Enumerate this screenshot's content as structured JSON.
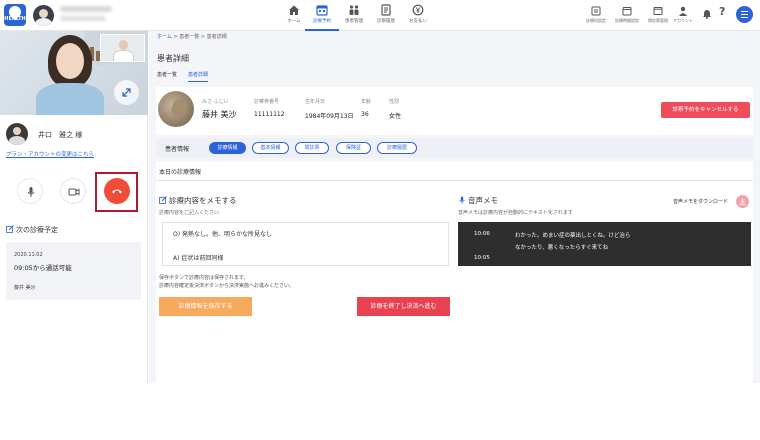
{
  "header": {
    "logo_text": "HEALTH",
    "nav": [
      {
        "label": "ホーム",
        "icon": "home-icon"
      },
      {
        "label": "診療予約",
        "icon": "calendar-icon",
        "active": true
      },
      {
        "label": "患者管理",
        "icon": "patients-icon"
      },
      {
        "label": "診察履歴",
        "icon": "history-icon"
      },
      {
        "label": "お支払い",
        "icon": "payment-icon"
      }
    ],
    "right_nav": [
      {
        "label": "診療科設定",
        "icon": "department-icon"
      },
      {
        "label": "診療時間設定",
        "icon": "schedule-icon"
      },
      {
        "label": "問診票管理",
        "icon": "questionnaire-icon"
      },
      {
        "label": "アカウント",
        "icon": "account-icon"
      }
    ],
    "help": "?"
  },
  "left_panel": {
    "patient_name": "井口　雅之 様",
    "plan_link": "プラン・アカウントの変更はこちら",
    "next": {
      "title": "次の診療予定",
      "date": "2020.11.02",
      "time": "09:05から通話可能",
      "patient": "藤井 美沙"
    }
  },
  "breadcrumb": {
    "home": "ホーム",
    "sep": " > ",
    "list": "患者一覧",
    "current": "患者詳細"
  },
  "page": {
    "title": "患者詳細",
    "tabs": [
      {
        "label": "患者一覧",
        "active": false
      },
      {
        "label": "患者詳細",
        "active": true
      }
    ]
  },
  "patient": {
    "kana": "みさ ふじい",
    "name": "藤井 美沙",
    "card_label": "診察券番号",
    "card_number": "11111112",
    "birth_label": "生年月日",
    "birth": "1984年09月13日",
    "age_label": "年齢",
    "age": "36",
    "sex_label": "性別",
    "sex": "女性",
    "cancel_button": "診察予約をキャンセルする"
  },
  "info_tabs": {
    "label": "患者情報",
    "items": [
      {
        "label": "診療情報",
        "active": true
      },
      {
        "label": "基本情報",
        "active": false
      },
      {
        "label": "問診票",
        "active": false
      },
      {
        "label": "保険証",
        "active": false
      },
      {
        "label": "診療履歴",
        "active": false
      }
    ]
  },
  "today": {
    "title": "本日の診療情報",
    "memo": {
      "title": "診療内容をメモする",
      "subtitle": "診療内容をご記入ください",
      "lines": [
        "O) 発熱なし。他、明らかな所見なし",
        "A) 症状は前回同様"
      ],
      "note1": "保存ボタンで診療内容は保存されます。",
      "note2": "診療内容確定後決済ボタンから決済実施へお進みください。",
      "save_button": "診療情報を保存する",
      "finish_button": "診療を終了し決済へ進む"
    },
    "voice": {
      "title": "音声メモ",
      "subtitle": "音声メモは診療内容が自動的にテキスト化されます",
      "download_label": "音声メモをダウンロード",
      "entries": [
        {
          "time": "10:06",
          "text": "わかった。めまい症の薬出しとくね。けど治ら"
        },
        {
          "time": "",
          "text": "なかったり、悪くなったらすぐ来てね"
        },
        {
          "time": "10:05",
          "text": ""
        }
      ]
    }
  },
  "colors": {
    "primary": "#2c64d6",
    "danger": "#ef4c5c",
    "save": "#f7a95c",
    "end_call": "#ef4c3a",
    "highlight_frame": "#b3182c"
  }
}
